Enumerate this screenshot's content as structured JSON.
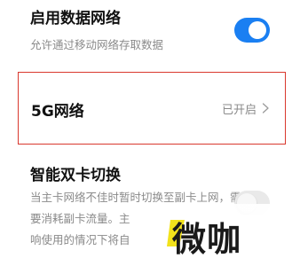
{
  "mobile_data": {
    "title": "启用数据网络",
    "description": "允许通过移动网络存取数据",
    "enabled": true
  },
  "network_5g": {
    "title": "5G网络",
    "status": "已开启"
  },
  "smart_dual_sim": {
    "title": "智能双卡切换",
    "description_lines": [
      "当主卡网络不佳时暂时切换至副卡上网，需",
      "要消耗副卡流量。主",
      "响使用的情况下将自"
    ],
    "enabled": false
  },
  "watermark": {
    "text": "微咖"
  },
  "colors": {
    "toggle_on": "#1a7ff2",
    "toggle_off": "#e9e9e9",
    "highlight_border": "#d9382e",
    "watermark_accent": "#f2e21b"
  }
}
